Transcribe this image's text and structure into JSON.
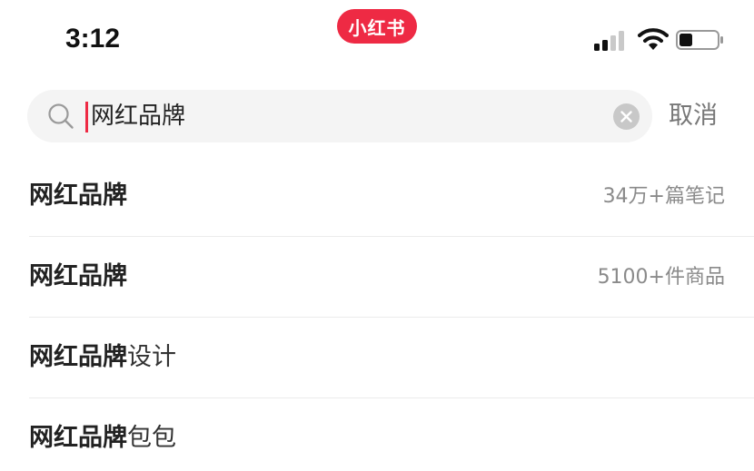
{
  "status_bar": {
    "time": "3:12",
    "app_badge": "小红书",
    "icons": [
      "signal-icon",
      "wifi-icon",
      "battery-icon"
    ]
  },
  "search": {
    "value": "网红品牌",
    "placeholder": "",
    "cancel_label": "取消",
    "icons": [
      "search-icon",
      "clear-icon"
    ]
  },
  "suggestions": [
    {
      "match": "网红品牌",
      "rest": "",
      "meta": "34万+篇笔记"
    },
    {
      "match": "网红品牌",
      "rest": "",
      "meta": "5100+件商品"
    },
    {
      "match": "网红品牌",
      "rest": "设计",
      "meta": ""
    },
    {
      "match": "网红品牌",
      "rest": "包包",
      "meta": ""
    }
  ],
  "colors": {
    "accent": "#ee2a44",
    "search_bg": "#f4f4f4",
    "meta_text": "#8a8a8a",
    "divider": "#ececec"
  }
}
